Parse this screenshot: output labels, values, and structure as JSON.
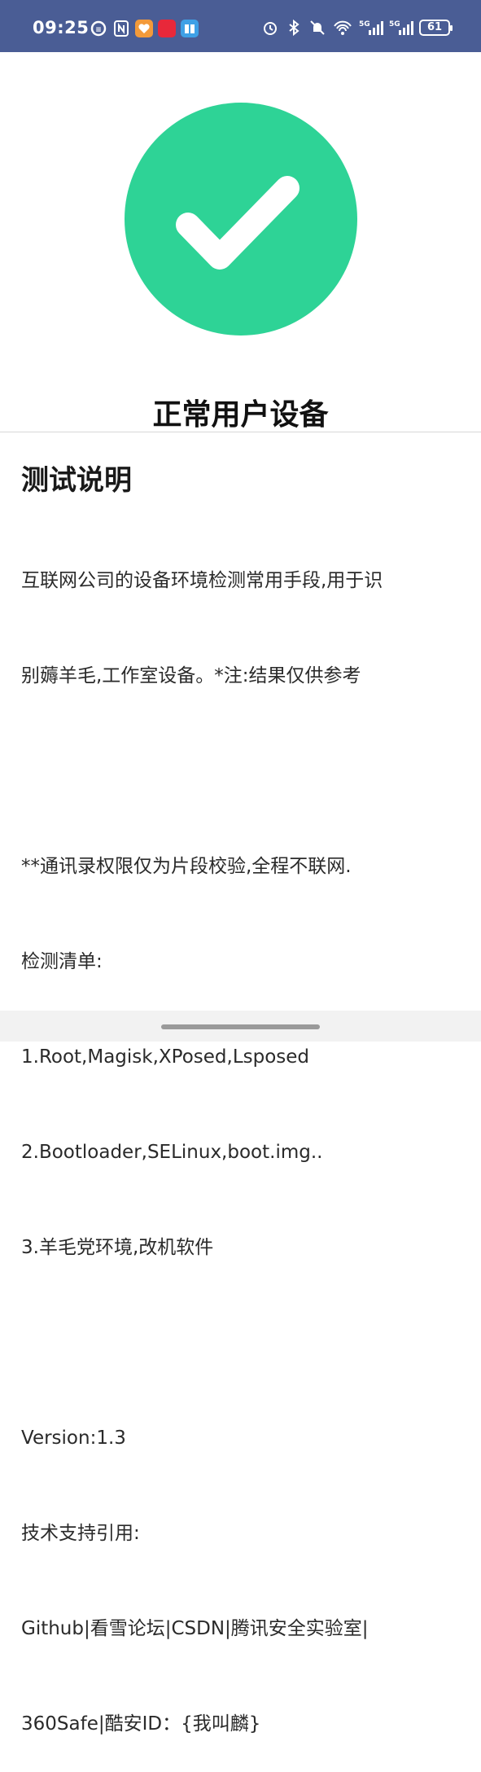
{
  "status_bar": {
    "time": "09:25",
    "battery": "61",
    "left_icons": [
      "ring-app-icon",
      "nfc-icon",
      "heart-app-icon",
      "xiaohongshu-app-icon",
      "book-app-icon"
    ],
    "right_icons": [
      "alarm-icon",
      "bluetooth-icon",
      "mute-icon",
      "wifi-icon",
      "signal-5g-icon",
      "signal-5g-icon"
    ],
    "colors": {
      "background": "#4a5d95"
    }
  },
  "result": {
    "icon": "check-icon",
    "title": "正常用户设备",
    "color": "#2ed396"
  },
  "description": {
    "heading": "测试说明",
    "lines": [
      "互联网公司的设备环境检测常用手段,用于识",
      "别薅羊毛,工作室设备。*注:结果仅供参考",
      "",
      "**通讯录权限仅为片段校验,全程不联网.",
      "检测清单:",
      "1.Root,Magisk,XPosed,Lsposed",
      "2.Bootloader,SELinux,boot.img..",
      "3.羊毛党环境,改机软件",
      "",
      "Version:1.3",
      "技术支持引用:",
      "Github|看雪论坛|CSDN|腾讯安全实验室|",
      "360Safe|酷安ID：{我叫麟}"
    ]
  }
}
